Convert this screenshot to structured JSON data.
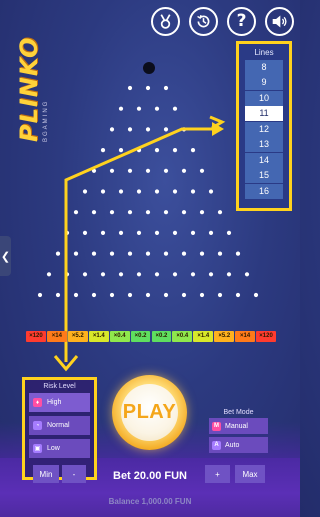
{
  "header": {
    "icons": [
      "medal-icon",
      "history-icon",
      "help-icon",
      "sound-icon"
    ],
    "help_glyph": "?"
  },
  "logo": {
    "title": "PLINKO",
    "subtitle": "BGAMING"
  },
  "board": {
    "rows": 11
  },
  "lines": {
    "title": "Lines",
    "options": [
      "8",
      "9",
      "10",
      "11",
      "12",
      "13",
      "14",
      "15",
      "16"
    ],
    "selected": "11"
  },
  "side_tab": {
    "glyph": "❮"
  },
  "multipliers": {
    "values": [
      "×120",
      "×14",
      "×5.2",
      "×1.4",
      "×0.4",
      "×0.2",
      "×0.2",
      "×0.4",
      "×1.4",
      "×5.2",
      "×14",
      "×120"
    ],
    "colors": [
      "#ff3b2f",
      "#ff7a1a",
      "#ffb11e",
      "#d8e82a",
      "#8fe84c",
      "#5fde5f",
      "#5fde5f",
      "#8fe84c",
      "#d8e82a",
      "#ffb11e",
      "#ff7a1a",
      "#ff3b2f"
    ]
  },
  "risk": {
    "title": "Risk Level",
    "options": [
      {
        "label": "High",
        "icon": "flame-icon",
        "color": "#ff4fa3"
      },
      {
        "label": "Normal",
        "icon": "gauge-icon",
        "color": "#a57cff"
      },
      {
        "label": "Low",
        "icon": "lock-icon",
        "color": "#a57cff"
      }
    ],
    "selected": "High"
  },
  "play": {
    "label": "PLAY"
  },
  "bet_mode": {
    "title": "Bet Mode",
    "options": [
      {
        "label": "Manual",
        "badge": "M",
        "color": "#ff4fa3"
      },
      {
        "label": "Auto",
        "badge": "A",
        "color": "#a57cff"
      }
    ]
  },
  "bet": {
    "min_label": "Min",
    "minus_label": "-",
    "amount_text": "Bet 20.00 FUN",
    "plus_label": "+",
    "max_label": "Max"
  },
  "balance": {
    "text": "Balance 1,000.00 FUN"
  },
  "colors": {
    "highlight": "#ffd21e",
    "accent": "#f4a61a"
  }
}
